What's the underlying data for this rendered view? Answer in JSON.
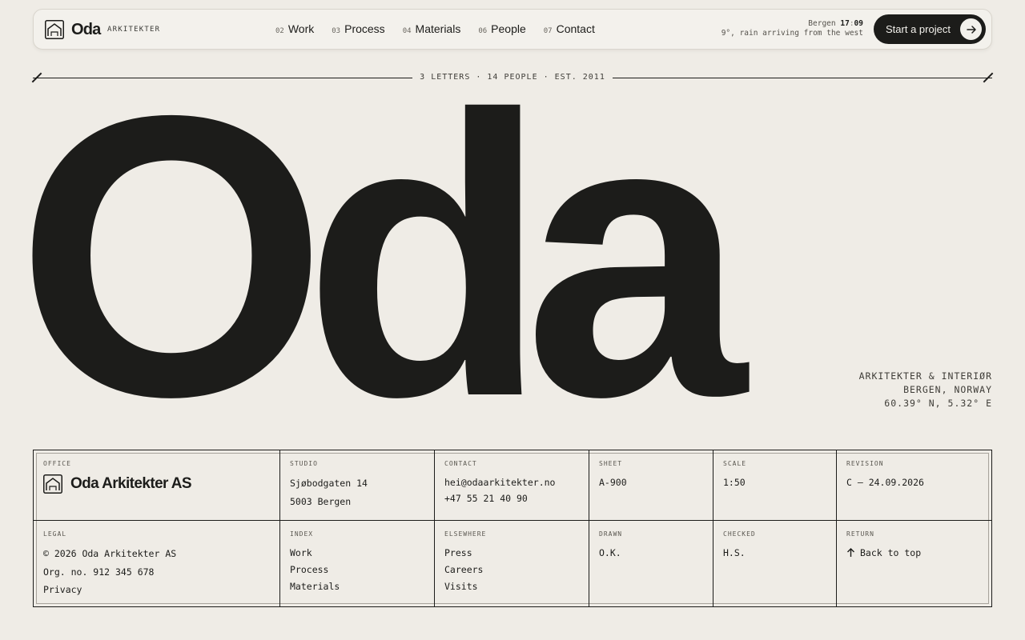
{
  "header": {
    "brand": "Oda",
    "brand_sub": "ARKITEKTER",
    "nav": [
      {
        "num": "02",
        "label": "Work"
      },
      {
        "num": "03",
        "label": "Process"
      },
      {
        "num": "04",
        "label": "Materials"
      },
      {
        "num": "06",
        "label": "People"
      },
      {
        "num": "07",
        "label": "Contact"
      }
    ],
    "weather_city": "Bergen",
    "weather_hour": "17",
    "weather_min": "09",
    "weather_desc": "9°, rain arriving from the west",
    "cta_label": "Start a project",
    "icons": {
      "logo": "house-icon",
      "cta": "arrow-right-icon"
    }
  },
  "rule": {
    "label": "3 LETTERS · 14 PEOPLE · EST. 2011"
  },
  "hero": {
    "word": "Oda",
    "meta": [
      "ARKITEKTER & INTERIØR",
      "BERGEN, NORWAY",
      "60.39° N, 5.32° E"
    ]
  },
  "block": {
    "office": {
      "label": "OFFICE",
      "name": "Oda Arkitekter AS"
    },
    "studio": {
      "label": "STUDIO",
      "lines": [
        "Sjøbodgaten 14",
        "5003 Bergen"
      ]
    },
    "contact": {
      "label": "CONTACT",
      "email": "hei@odaarkitekter.no",
      "phone": "+47 55 21 40 90"
    },
    "sheet": {
      "label": "SHEET",
      "value": "A-900"
    },
    "scale": {
      "label": "SCALE",
      "value": "1:50"
    },
    "revision": {
      "label": "REVISION",
      "value": "C — 24.09.2026"
    },
    "legal": {
      "label": "LEGAL",
      "lines": [
        "© 2026 Oda Arkitekter AS",
        "Org. no. 912 345 678"
      ],
      "privacy": "Privacy"
    },
    "index": {
      "label": "INDEX",
      "links": [
        "Work",
        "Process",
        "Materials"
      ]
    },
    "elsewhere": {
      "label": "ELSEWHERE",
      "links": [
        "Press",
        "Careers",
        "Visits"
      ]
    },
    "drawn": {
      "label": "DRAWN",
      "value": "O.K."
    },
    "checked": {
      "label": "CHECKED",
      "value": "H.S."
    },
    "return": {
      "label": "RETURN",
      "value": "Back to top",
      "icon": "arrow-up-icon"
    }
  }
}
